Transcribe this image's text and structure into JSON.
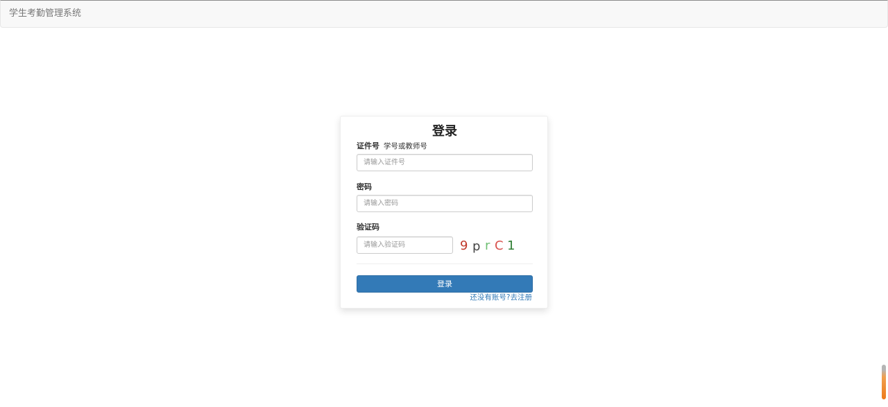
{
  "navbar": {
    "brand": "学生考勤管理系统"
  },
  "login": {
    "title": "登录",
    "id_label": "证件号",
    "id_hint": "学号或教师号",
    "id_placeholder": "请输入证件号",
    "password_label": "密码",
    "password_placeholder": "请输入密码",
    "captcha_label": "验证码",
    "captcha_placeholder": "请输入验证码",
    "captcha_chars": [
      {
        "char": "9",
        "color": "#c0392b"
      },
      {
        "char": "p",
        "color": "#444444"
      },
      {
        "char": "r",
        "color": "#6fbf73"
      },
      {
        "char": "C",
        "color": "#d9534f"
      },
      {
        "char": "1",
        "color": "#2e7d32"
      }
    ],
    "submit_label": "登录",
    "register_link": "还没有账号?去注册"
  },
  "colors": {
    "primary": "#337ab7",
    "navbar_bg": "#f8f8f8"
  }
}
